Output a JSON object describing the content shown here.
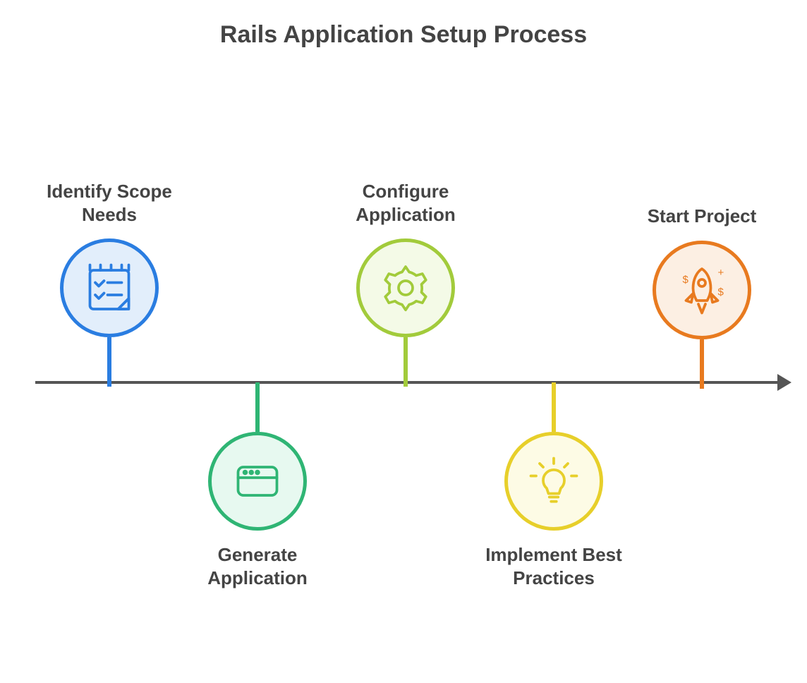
{
  "title": "Rails Application Setup Process",
  "steps": [
    {
      "label": "Identify Scope Needs",
      "icon": "checklist-icon",
      "color": "blue",
      "position": "above"
    },
    {
      "label": "Generate Application",
      "icon": "window-icon",
      "color": "green",
      "position": "below"
    },
    {
      "label": "Configure Application",
      "icon": "gear-icon",
      "color": "lime",
      "position": "above"
    },
    {
      "label": "Implement Best Practices",
      "icon": "lightbulb-icon",
      "color": "yellow",
      "position": "below"
    },
    {
      "label": "Start Project",
      "icon": "rocket-icon",
      "color": "orange",
      "position": "above"
    }
  ],
  "colors": {
    "blue": "#2a7de1",
    "green": "#2fb574",
    "lime": "#a2cb3b",
    "yellow": "#e7cf2a",
    "orange": "#e87a1f"
  }
}
